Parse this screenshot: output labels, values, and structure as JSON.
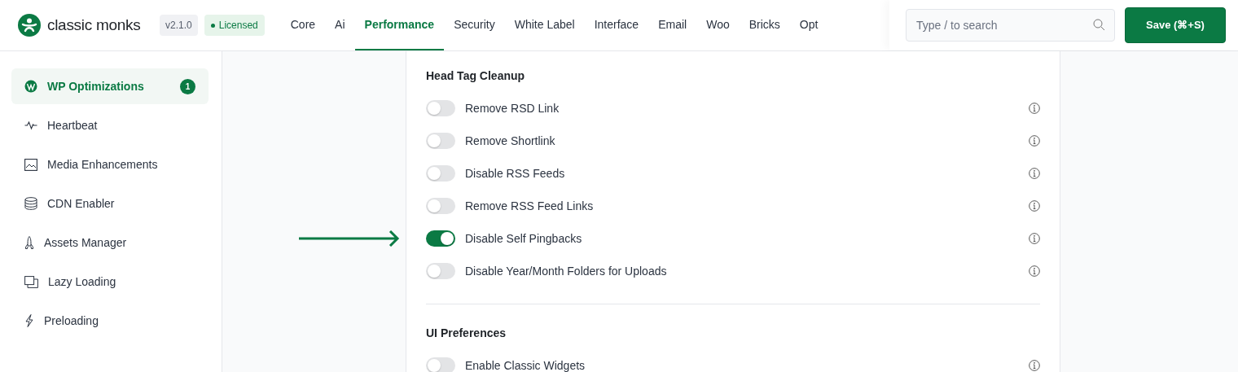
{
  "brand": {
    "name": "classic monks",
    "version": "v2.1.0",
    "license": "Licensed"
  },
  "tabs": [
    {
      "label": "Core",
      "selected": false
    },
    {
      "label": "Ai",
      "selected": false
    },
    {
      "label": "Performance",
      "selected": true
    },
    {
      "label": "Security",
      "selected": false
    },
    {
      "label": "White Label",
      "selected": false
    },
    {
      "label": "Interface",
      "selected": false
    },
    {
      "label": "Email",
      "selected": false
    },
    {
      "label": "Woo",
      "selected": false
    },
    {
      "label": "Bricks",
      "selected": false
    },
    {
      "label": "Opt",
      "selected": false
    }
  ],
  "search": {
    "placeholder": "Type / to search"
  },
  "save_button": "Save (⌘+S)",
  "sidebar": {
    "items": [
      {
        "label": "WP Optimizations",
        "selected": true,
        "badge": "1"
      },
      {
        "label": "Heartbeat",
        "selected": false
      },
      {
        "label": "Media Enhancements",
        "selected": false
      },
      {
        "label": "CDN Enabler",
        "selected": false
      },
      {
        "label": "Assets Manager",
        "selected": false
      },
      {
        "label": "Lazy Loading",
        "selected": false
      },
      {
        "label": "Preloading",
        "selected": false
      }
    ]
  },
  "sections": [
    {
      "title": "Head Tag Cleanup",
      "options": [
        {
          "label": "Remove RSD Link",
          "on": false
        },
        {
          "label": "Remove Shortlink",
          "on": false
        },
        {
          "label": "Disable RSS Feeds",
          "on": false
        },
        {
          "label": "Remove RSS Feed Links",
          "on": false
        },
        {
          "label": "Disable Self Pingbacks",
          "on": true,
          "pointed": true
        },
        {
          "label": "Disable Year/Month Folders for Uploads",
          "on": false
        }
      ]
    },
    {
      "title": "UI Preferences",
      "options": [
        {
          "label": "Enable Classic Widgets",
          "on": false
        }
      ]
    }
  ]
}
